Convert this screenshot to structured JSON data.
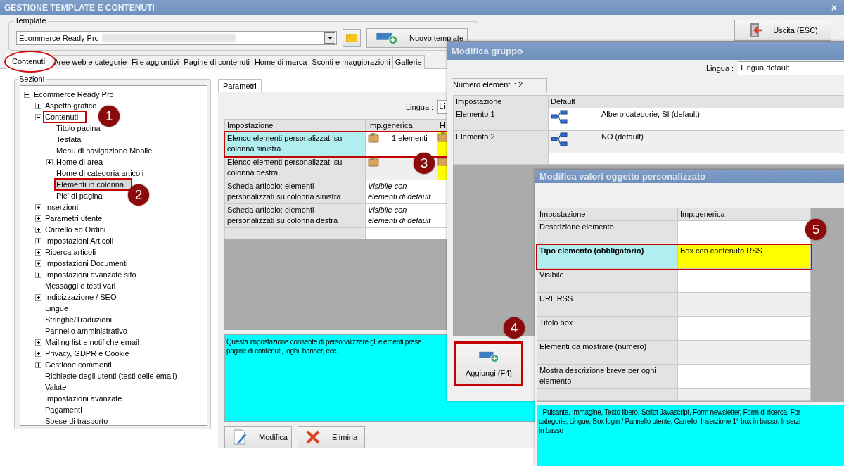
{
  "window": {
    "title": "GESTIONE TEMPLATE E CONTENUTI",
    "close": "×"
  },
  "template": {
    "label": "Template",
    "value": "Ecommerce Ready Pro",
    "redacted": true,
    "new_button": "Nuovo template"
  },
  "exit_button": "Uscita (ESC)",
  "tabs": [
    {
      "label": "Contenuti",
      "selected": true,
      "circled": true
    },
    {
      "label": "Aree web e categorie",
      "selected": false,
      "circled": false
    },
    {
      "label": "File aggiuntivi",
      "selected": false,
      "circled": false
    },
    {
      "label": "Pagine di contenuti",
      "selected": false,
      "circled": false
    },
    {
      "label": "Home di marca",
      "selected": false,
      "circled": false
    },
    {
      "label": "Sconti e maggiorazioni",
      "selected": false,
      "circled": false
    },
    {
      "label": "Gallerie",
      "selected": false,
      "circled": false
    }
  ],
  "sections": {
    "title": "Sezioni",
    "tree": [
      {
        "label": "Ecommerce Ready Pro",
        "expanded": true,
        "selected": false,
        "highlighted": false,
        "children": [
          {
            "label": "Aspetto grafico",
            "expanded": false,
            "selected": false,
            "highlighted": false
          },
          {
            "label": "Contenuti",
            "expanded": true,
            "selected": false,
            "highlighted": true,
            "children": [
              {
                "label": "Titolo pagina",
                "selected": false,
                "highlighted": false
              },
              {
                "label": "Testata",
                "selected": false,
                "highlighted": false
              },
              {
                "label": "Menu di navigazione Mobile",
                "selected": false,
                "highlighted": false
              },
              {
                "label": "Home di area",
                "expanded": false,
                "selected": false,
                "highlighted": false
              },
              {
                "label": "Home di categoria articoli",
                "selected": false,
                "highlighted": false
              },
              {
                "label": "Elementi in colonna",
                "selected": true,
                "highlighted": true
              },
              {
                "label": "Pie' di pagina",
                "selected": false,
                "highlighted": false
              }
            ]
          },
          {
            "label": "Inserzioni",
            "expanded": false,
            "selected": false,
            "highlighted": false
          },
          {
            "label": "Parametri utente",
            "expanded": false,
            "selected": false,
            "highlighted": false
          },
          {
            "label": "Carrello ed Ordini",
            "expanded": false,
            "selected": false,
            "highlighted": false
          },
          {
            "label": "Impostazioni Articoli",
            "expanded": false,
            "selected": false,
            "highlighted": false
          },
          {
            "label": "Ricerca articoli",
            "expanded": false,
            "selected": false,
            "highlighted": false
          },
          {
            "label": "Impostazioni Documenti",
            "expanded": false,
            "selected": false,
            "highlighted": false
          },
          {
            "label": "Impostazioni avanzate sito",
            "expanded": false,
            "selected": false,
            "highlighted": false
          },
          {
            "label": "Messaggi e testi vari",
            "selected": false,
            "highlighted": false
          },
          {
            "label": "Indicizzazione / SEO",
            "expanded": false,
            "selected": false,
            "highlighted": false
          },
          {
            "label": "Lingue",
            "selected": false,
            "highlighted": false
          },
          {
            "label": "Stringhe/Traduzioni",
            "selected": false,
            "highlighted": false
          },
          {
            "label": "Pannello amministrativo",
            "selected": false,
            "highlighted": false
          },
          {
            "label": "Mailing list e notifiche email",
            "expanded": false,
            "selected": false,
            "highlighted": false
          },
          {
            "label": "Privacy, GDPR e Cookie",
            "expanded": false,
            "selected": false,
            "highlighted": false
          },
          {
            "label": "Gestione commenti",
            "expanded": false,
            "selected": false,
            "highlighted": false
          },
          {
            "label": "Richieste degli utenti (testi delle email)",
            "selected": false,
            "highlighted": false
          },
          {
            "label": "Valute",
            "selected": false,
            "highlighted": false
          },
          {
            "label": "Impostazioni avanzate",
            "selected": false,
            "highlighted": false
          },
          {
            "label": "Pagamenti",
            "selected": false,
            "highlighted": false
          },
          {
            "label": "Spese di trasporto",
            "selected": false,
            "highlighted": false
          }
        ]
      }
    ]
  },
  "params": {
    "tab": "Parametri",
    "language_label": "Lingua :",
    "language_value": "Li",
    "columns": [
      "Impostazione",
      "Imp.generica",
      "H"
    ],
    "rows": [
      {
        "setting": "Elenco elementi personalizzati su colonna sinistra",
        "selected": true,
        "highlighted": true,
        "generic": {
          "kind": "folder",
          "text": "1 elementi"
        },
        "other": {
          "kind": "flagged"
        }
      },
      {
        "setting": "Elenco elementi personalizzati su colonna destra",
        "selected": false,
        "highlighted": false,
        "generic": {
          "kind": "folder"
        },
        "other": {
          "kind": "flagged"
        }
      },
      {
        "setting": "Scheda articolo: elementi personalizzati su colonna sinistra",
        "selected": false,
        "highlighted": false,
        "generic": {
          "kind": "inherited",
          "text": "Visibile con elementi di default"
        },
        "other": {
          "kind": "empty"
        }
      },
      {
        "setting": "Scheda articolo: elementi personalizzati su colonna destra",
        "selected": false,
        "highlighted": false,
        "generic": {
          "kind": "inherited",
          "text": "Visibile con elementi di default"
        },
        "other": {
          "kind": "empty"
        }
      }
    ],
    "description": [
      "Questa impostazione consente di personalizzare gli elementi prese",
      "pagine di contenuti, loghi, banner, ecc."
    ],
    "buttons": [
      {
        "label": "Modifica",
        "kind": "edit"
      },
      {
        "label": "Elimina",
        "kind": "delete"
      }
    ]
  },
  "group_dialog": {
    "title": "Modifica gruppo",
    "language_label": "Lingua :",
    "language_value": "Lingua default",
    "count": "Numero elementi : 2",
    "columns": [
      "Impostazione",
      "Default"
    ],
    "rows": [
      {
        "setting": "Elemento 1",
        "value": "Albero categorie, SI (default)"
      },
      {
        "setting": "Elemento 2",
        "value": "NO (default)"
      }
    ],
    "add_button": {
      "label": "Aggiungi (F4)",
      "highlighted": true
    }
  },
  "object_dialog": {
    "title": "Modifica valori oggetto personalizzato",
    "columns": [
      "Impostazione",
      "Imp.generica"
    ],
    "rows": [
      {
        "setting": "Descrizione elemento",
        "required": false,
        "selected": false,
        "highlighted": false
      },
      {
        "setting": "Tipo elemento (obbligatorio)",
        "value": "Box con contenuto RSS",
        "required": true,
        "selected": true,
        "highlighted": true
      },
      {
        "setting": "Visibile",
        "required": false,
        "selected": false,
        "highlighted": false
      },
      {
        "setting": "URL RSS",
        "required": false,
        "selected": false,
        "highlighted": false
      },
      {
        "setting": "Titolo box",
        "required": false,
        "selected": false,
        "highlighted": false
      },
      {
        "setting": "Elementi da mostrare (numero)",
        "required": false,
        "selected": false,
        "highlighted": false
      },
      {
        "setting": "Mostra descrizione breve per ogni elemento",
        "required": false,
        "selected": false,
        "highlighted": false
      }
    ],
    "description": [
      "- Pulsante, Immagine, Testo libero, Script Javascript, Form newsletter, Form di ricerca, For",
      "categorie, Lingue, Box login / Pannello utente, Carrello, Inserzione 1° box in basso, Inserzi",
      "in basso"
    ]
  },
  "annotations": [
    {
      "number": "1"
    },
    {
      "number": "2"
    },
    {
      "number": "3"
    },
    {
      "number": "4"
    },
    {
      "number": "5"
    }
  ]
}
